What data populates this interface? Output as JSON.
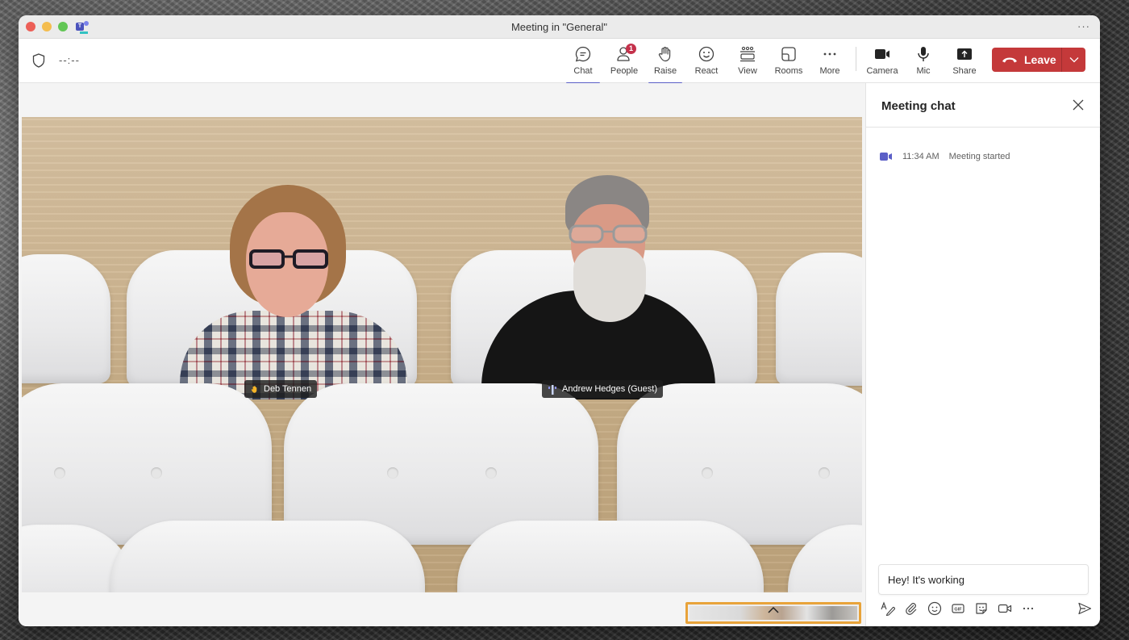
{
  "window": {
    "title": "Meeting in \"General\"",
    "more_label": "···"
  },
  "toolbar": {
    "timer": "--:--",
    "buttons": [
      {
        "id": "chat",
        "label": "Chat",
        "active": true
      },
      {
        "id": "people",
        "label": "People",
        "badge": "1"
      },
      {
        "id": "raise",
        "label": "Raise",
        "active": true
      },
      {
        "id": "react",
        "label": "React"
      },
      {
        "id": "view",
        "label": "View"
      },
      {
        "id": "rooms",
        "label": "Rooms"
      },
      {
        "id": "more",
        "label": "More"
      },
      {
        "id": "camera",
        "label": "Camera"
      },
      {
        "id": "mic",
        "label": "Mic"
      },
      {
        "id": "share",
        "label": "Share"
      }
    ],
    "leave_label": "Leave",
    "leave_color": "#c4393a",
    "accent_color": "#5b5fc7"
  },
  "stage": {
    "participants": [
      {
        "name": "Deb Tennen",
        "status_icon": "raised-hand-icon"
      },
      {
        "name": "Andrew Hedges (Guest)",
        "status_icon": "audio-level-icon"
      }
    ],
    "self_view_highlight": "#e8a33a"
  },
  "chat": {
    "title": "Meeting chat",
    "events": [
      {
        "icon": "video-camera-icon",
        "time": "11:34 AM",
        "message": "Meeting started"
      }
    ],
    "compose_value": "Hey! It's working",
    "tools": [
      "format-icon",
      "attach-icon",
      "emoji-icon",
      "gif-icon",
      "sticker-icon",
      "video-clip-icon",
      "more-icon",
      "send-icon"
    ]
  }
}
